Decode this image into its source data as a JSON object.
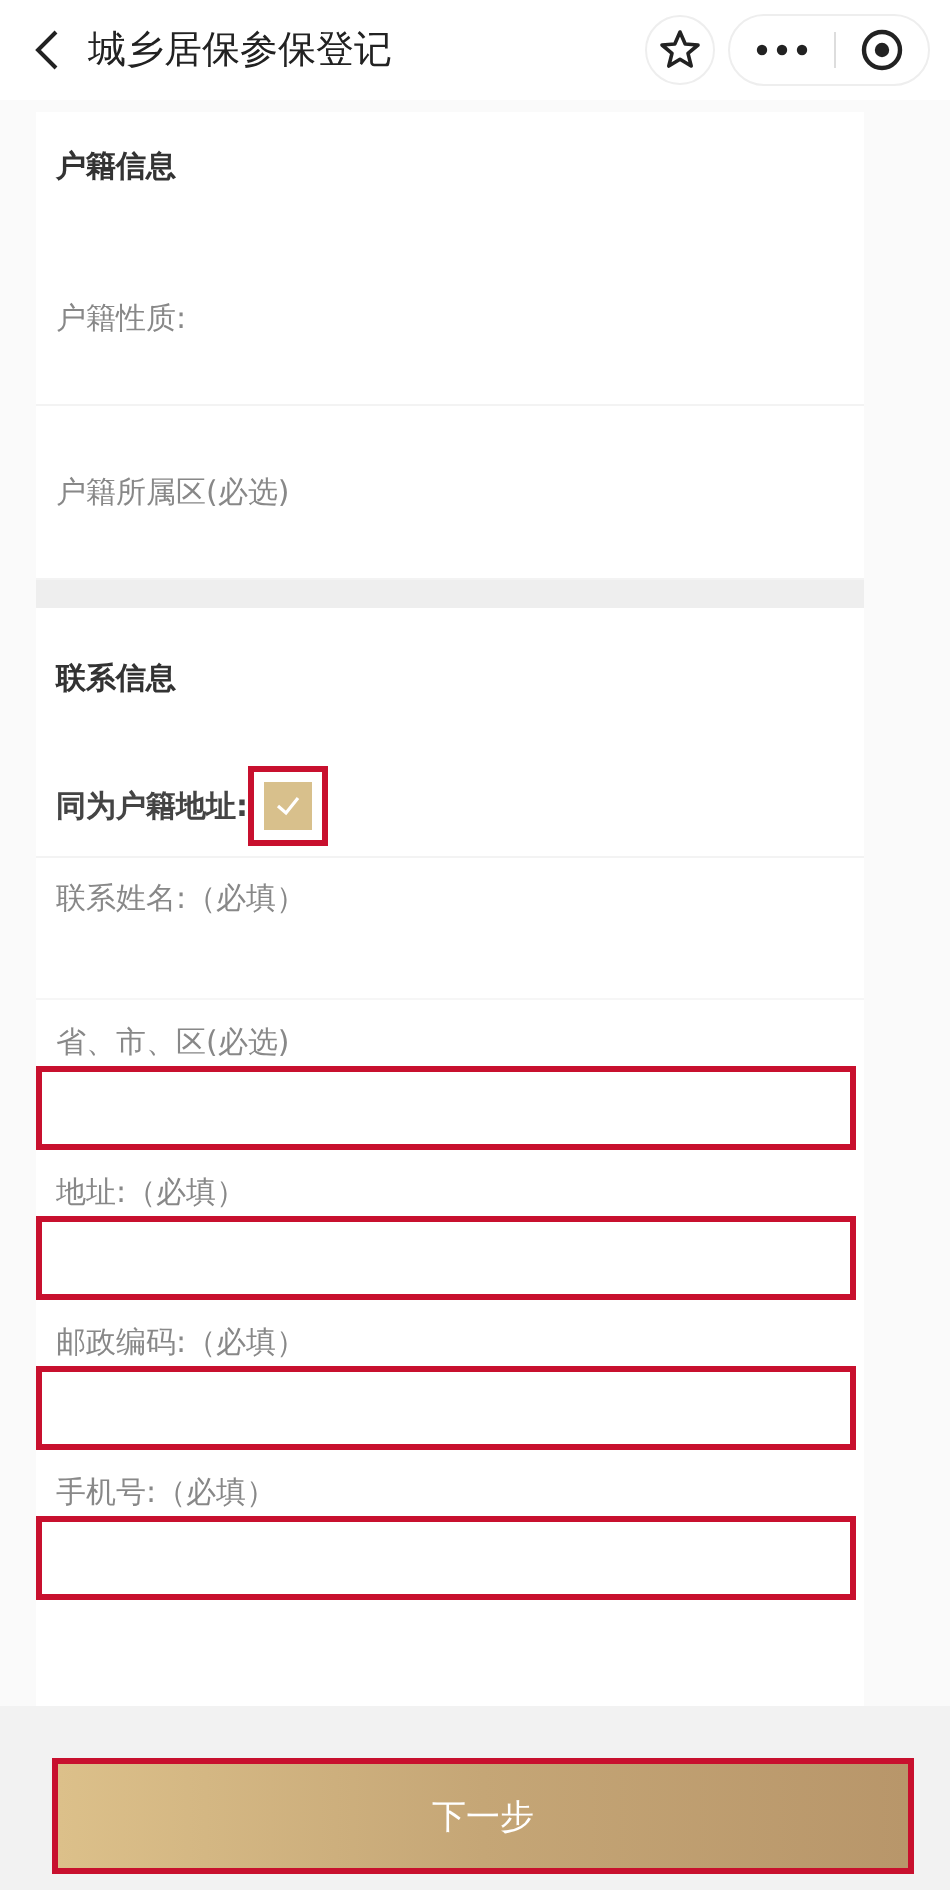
{
  "header": {
    "title": "城乡居保参保登记"
  },
  "household": {
    "title": "户籍信息",
    "rows": [
      {
        "label": "户籍性质:"
      },
      {
        "label": "户籍所属区(必选)"
      }
    ]
  },
  "contact": {
    "title": "联系信息",
    "same_address": {
      "label": "同为户籍地址:",
      "checked": true,
      "highlighted": true
    },
    "name_label": "联系姓名:（必填）",
    "fields": [
      {
        "label": "省、市、区(必选)",
        "highlighted": true
      },
      {
        "label": "地址:（必填）",
        "highlighted": true
      },
      {
        "label": "邮政编码:（必填）",
        "highlighted": true
      },
      {
        "label": "手机号:（必填）",
        "highlighted": true
      }
    ]
  },
  "next_button": {
    "label": "下一步",
    "highlighted": true
  }
}
